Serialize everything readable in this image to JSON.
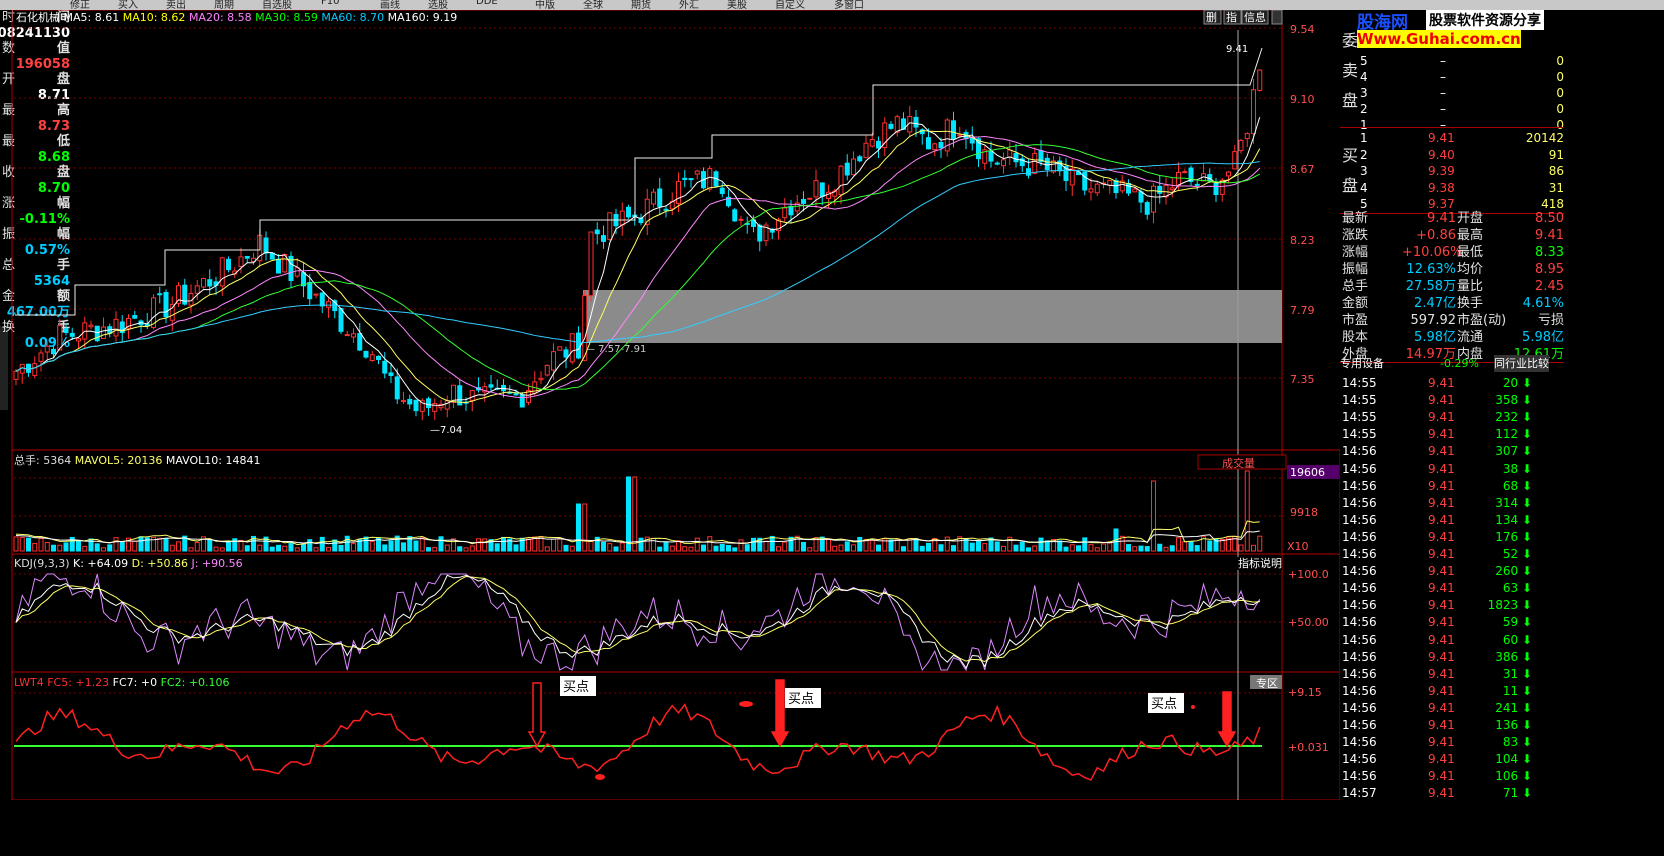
{
  "toolbar": {
    "items": [
      "修正",
      "买入",
      "卖出",
      "周期",
      "自选股",
      "F10",
      "画线",
      "选股",
      "DDE",
      "中版",
      "全球",
      "期货",
      "外汇",
      "美股",
      "自定义",
      "多窗口"
    ]
  },
  "stock": {
    "name": "石化机械",
    "ma": [
      {
        "label": "MA5: 8.61",
        "color": "#ffffff"
      },
      {
        "label": "MA10: 8.62",
        "color": "#ffff00"
      },
      {
        "label": "MA20: 8.58",
        "color": "#ff80ff"
      },
      {
        "label": "MA30: 8.59",
        "color": "#00ff00"
      },
      {
        "label": "MA60: 8.70",
        "color": "#00ccff"
      },
      {
        "label": "MA160: 9.19",
        "color": "#ffffff"
      }
    ]
  },
  "tabs": {
    "t1": "删",
    "t2": "指",
    "t3": "信息"
  },
  "left": {
    "rows": [
      {
        "l": "时",
        "v": "间",
        "lc": "#e0e0e0",
        "vc": "#e0e0e0"
      },
      {
        "l": "",
        "v": "08241130",
        "lc": "#e0e0e0",
        "vc": "#ffffff"
      },
      {
        "l": "数",
        "v": "值",
        "lc": "#e0e0e0",
        "vc": "#e0e0e0"
      },
      {
        "l": "",
        "v": "196058",
        "lc": "#e0e0e0",
        "vc": "#ff4040"
      },
      {
        "l": "开",
        "v": "盘",
        "lc": "#e0e0e0",
        "vc": "#e0e0e0"
      },
      {
        "l": "",
        "v": "8.71",
        "lc": "#e0e0e0",
        "vc": "#ffffff"
      },
      {
        "l": "最",
        "v": "高",
        "lc": "#e0e0e0",
        "vc": "#e0e0e0"
      },
      {
        "l": "",
        "v": "8.73",
        "lc": "#e0e0e0",
        "vc": "#ff4040"
      },
      {
        "l": "最",
        "v": "低",
        "lc": "#e0e0e0",
        "vc": "#e0e0e0"
      },
      {
        "l": "",
        "v": "8.68",
        "lc": "#e0e0e0",
        "vc": "#00ff00"
      },
      {
        "l": "收",
        "v": "盘",
        "lc": "#e0e0e0",
        "vc": "#e0e0e0"
      },
      {
        "l": "",
        "v": "8.70",
        "lc": "#e0e0e0",
        "vc": "#00ff00"
      },
      {
        "l": "涨",
        "v": "幅",
        "lc": "#e0e0e0",
        "vc": "#e0e0e0"
      },
      {
        "l": "",
        "v": "-0.11%",
        "lc": "#e0e0e0",
        "vc": "#00ff00"
      },
      {
        "l": "振",
        "v": "幅",
        "lc": "#e0e0e0",
        "vc": "#e0e0e0"
      },
      {
        "l": "",
        "v": "0.57%",
        "lc": "#e0e0e0",
        "vc": "#00ccff"
      },
      {
        "l": "总",
        "v": "手",
        "lc": "#e0e0e0",
        "vc": "#e0e0e0"
      },
      {
        "l": "",
        "v": "5364",
        "lc": "#e0e0e0",
        "vc": "#00ccff"
      },
      {
        "l": "金",
        "v": "额",
        "lc": "#e0e0e0",
        "vc": "#e0e0e0"
      },
      {
        "l": "",
        "v": "467.00万",
        "lc": "#e0e0e0",
        "vc": "#00ccff"
      },
      {
        "l": "换",
        "v": "手",
        "lc": "#e0e0e0",
        "vc": "#e0e0e0"
      },
      {
        "l": "",
        "v": "0.09%",
        "lc": "#e0e0e0",
        "vc": "#00ccff"
      }
    ]
  },
  "price_axis": [
    "9.54",
    "9.10",
    "8.67",
    "8.23",
    "7.79",
    "7.35"
  ],
  "annotations": {
    "high": "9.41",
    "low": "7.04",
    "range": "7.57-7.91"
  },
  "volume": {
    "title": "总手: 5364",
    "mavol5": "MAVOL5: 20136",
    "mavol10": "MAVOL10: 14841",
    "dropdown": "成交量",
    "axis": [
      "19606",
      "9918",
      "X10"
    ]
  },
  "kdj": {
    "title": "KDJ(9,3,3)",
    "k": "K: +64.09",
    "d": "D: +50.86",
    "j": "J: +90.56",
    "button": "指标说明",
    "axis": [
      "+100.0",
      "+50.00"
    ]
  },
  "lwt": {
    "title": "LWT4",
    "fc5": "FC5: +1.23",
    "fc7": "FC7: +0",
    "fc2": "FC2: +0.106",
    "button": "专区",
    "axis": [
      "+9.15",
      "+0.031"
    ],
    "buy": "买点"
  },
  "right": {
    "logo1": "股海网",
    "logo2": "股票软件资源分享",
    "logo3": "Www.Guhai.com.cn",
    "sell_label": [
      "委",
      "卖",
      "盘"
    ],
    "sells": [
      {
        "n": "5",
        "p": "–",
        "v": "0"
      },
      {
        "n": "4",
        "p": "–",
        "v": "0"
      },
      {
        "n": "3",
        "p": "–",
        "v": "0"
      },
      {
        "n": "2",
        "p": "–",
        "v": "0"
      },
      {
        "n": "1",
        "p": "–",
        "v": "0"
      }
    ],
    "buy_label": [
      "买",
      "盘"
    ],
    "buys": [
      {
        "n": "1",
        "p": "9.41",
        "v": "20142"
      },
      {
        "n": "2",
        "p": "9.40",
        "v": "91"
      },
      {
        "n": "3",
        "p": "9.39",
        "v": "86"
      },
      {
        "n": "4",
        "p": "9.38",
        "v": "31"
      },
      {
        "n": "5",
        "p": "9.37",
        "v": "418"
      }
    ],
    "quotes": [
      {
        "a": "最新",
        "av": "9.41",
        "ac": "#ff4040",
        "b": "开盘",
        "bv": "8.50",
        "bc": "#ff4040"
      },
      {
        "a": "涨跌",
        "av": "+0.86",
        "ac": "#ff4040",
        "b": "最高",
        "bv": "9.41",
        "bc": "#ff4040"
      },
      {
        "a": "涨幅",
        "av": "+10.06%",
        "ac": "#ff4040",
        "b": "最低",
        "bv": "8.33",
        "bc": "#00ff00"
      },
      {
        "a": "振幅",
        "av": "12.63%",
        "ac": "#00ccff",
        "b": "均价",
        "bv": "8.95",
        "bc": "#ff4040"
      },
      {
        "a": "总手",
        "av": "27.58万",
        "ac": "#00ccff",
        "b": "量比",
        "bv": "2.45",
        "bc": "#ff4040"
      },
      {
        "a": "金额",
        "av": "2.47亿",
        "ac": "#00ccff",
        "b": "换手",
        "bv": "4.61%",
        "bc": "#00ccff"
      },
      {
        "a": "市盈",
        "av": "597.92",
        "ac": "#e0e0e0",
        "b": "市盈(动)",
        "bv": "亏损",
        "bc": "#e0e0e0"
      },
      {
        "a": "股本",
        "av": "5.98亿",
        "ac": "#00ccff",
        "b": "流通",
        "bv": "5.98亿",
        "bc": "#00ccff"
      },
      {
        "a": "外盘",
        "av": "14.97万",
        "ac": "#ff4040",
        "b": "内盘",
        "bv": "12.61万",
        "bc": "#00ff00"
      }
    ],
    "sector": "专用设备",
    "sector_chg": "-0.29%",
    "compare": "同行业比较",
    "ticks": [
      {
        "t": "14:55",
        "p": "9.41",
        "v": "20"
      },
      {
        "t": "14:55",
        "p": "9.41",
        "v": "358"
      },
      {
        "t": "14:55",
        "p": "9.41",
        "v": "232"
      },
      {
        "t": "14:55",
        "p": "9.41",
        "v": "112"
      },
      {
        "t": "14:56",
        "p": "9.41",
        "v": "307"
      },
      {
        "t": "14:56",
        "p": "9.41",
        "v": "38"
      },
      {
        "t": "14:56",
        "p": "9.41",
        "v": "68"
      },
      {
        "t": "14:56",
        "p": "9.41",
        "v": "314"
      },
      {
        "t": "14:56",
        "p": "9.41",
        "v": "134"
      },
      {
        "t": "14:56",
        "p": "9.41",
        "v": "176"
      },
      {
        "t": "14:56",
        "p": "9.41",
        "v": "52"
      },
      {
        "t": "14:56",
        "p": "9.41",
        "v": "260"
      },
      {
        "t": "14:56",
        "p": "9.41",
        "v": "63"
      },
      {
        "t": "14:56",
        "p": "9.41",
        "v": "1823"
      },
      {
        "t": "14:56",
        "p": "9.41",
        "v": "59"
      },
      {
        "t": "14:56",
        "p": "9.41",
        "v": "60"
      },
      {
        "t": "14:56",
        "p": "9.41",
        "v": "386"
      },
      {
        "t": "14:56",
        "p": "9.41",
        "v": "31"
      },
      {
        "t": "14:56",
        "p": "9.41",
        "v": "11"
      },
      {
        "t": "14:56",
        "p": "9.41",
        "v": "241"
      },
      {
        "t": "14:56",
        "p": "9.41",
        "v": "136"
      },
      {
        "t": "14:56",
        "p": "9.41",
        "v": "83"
      },
      {
        "t": "14:56",
        "p": "9.41",
        "v": "104"
      },
      {
        "t": "14:56",
        "p": "9.41",
        "v": "106"
      },
      {
        "t": "14:57",
        "p": "9.41",
        "v": "71"
      }
    ]
  }
}
